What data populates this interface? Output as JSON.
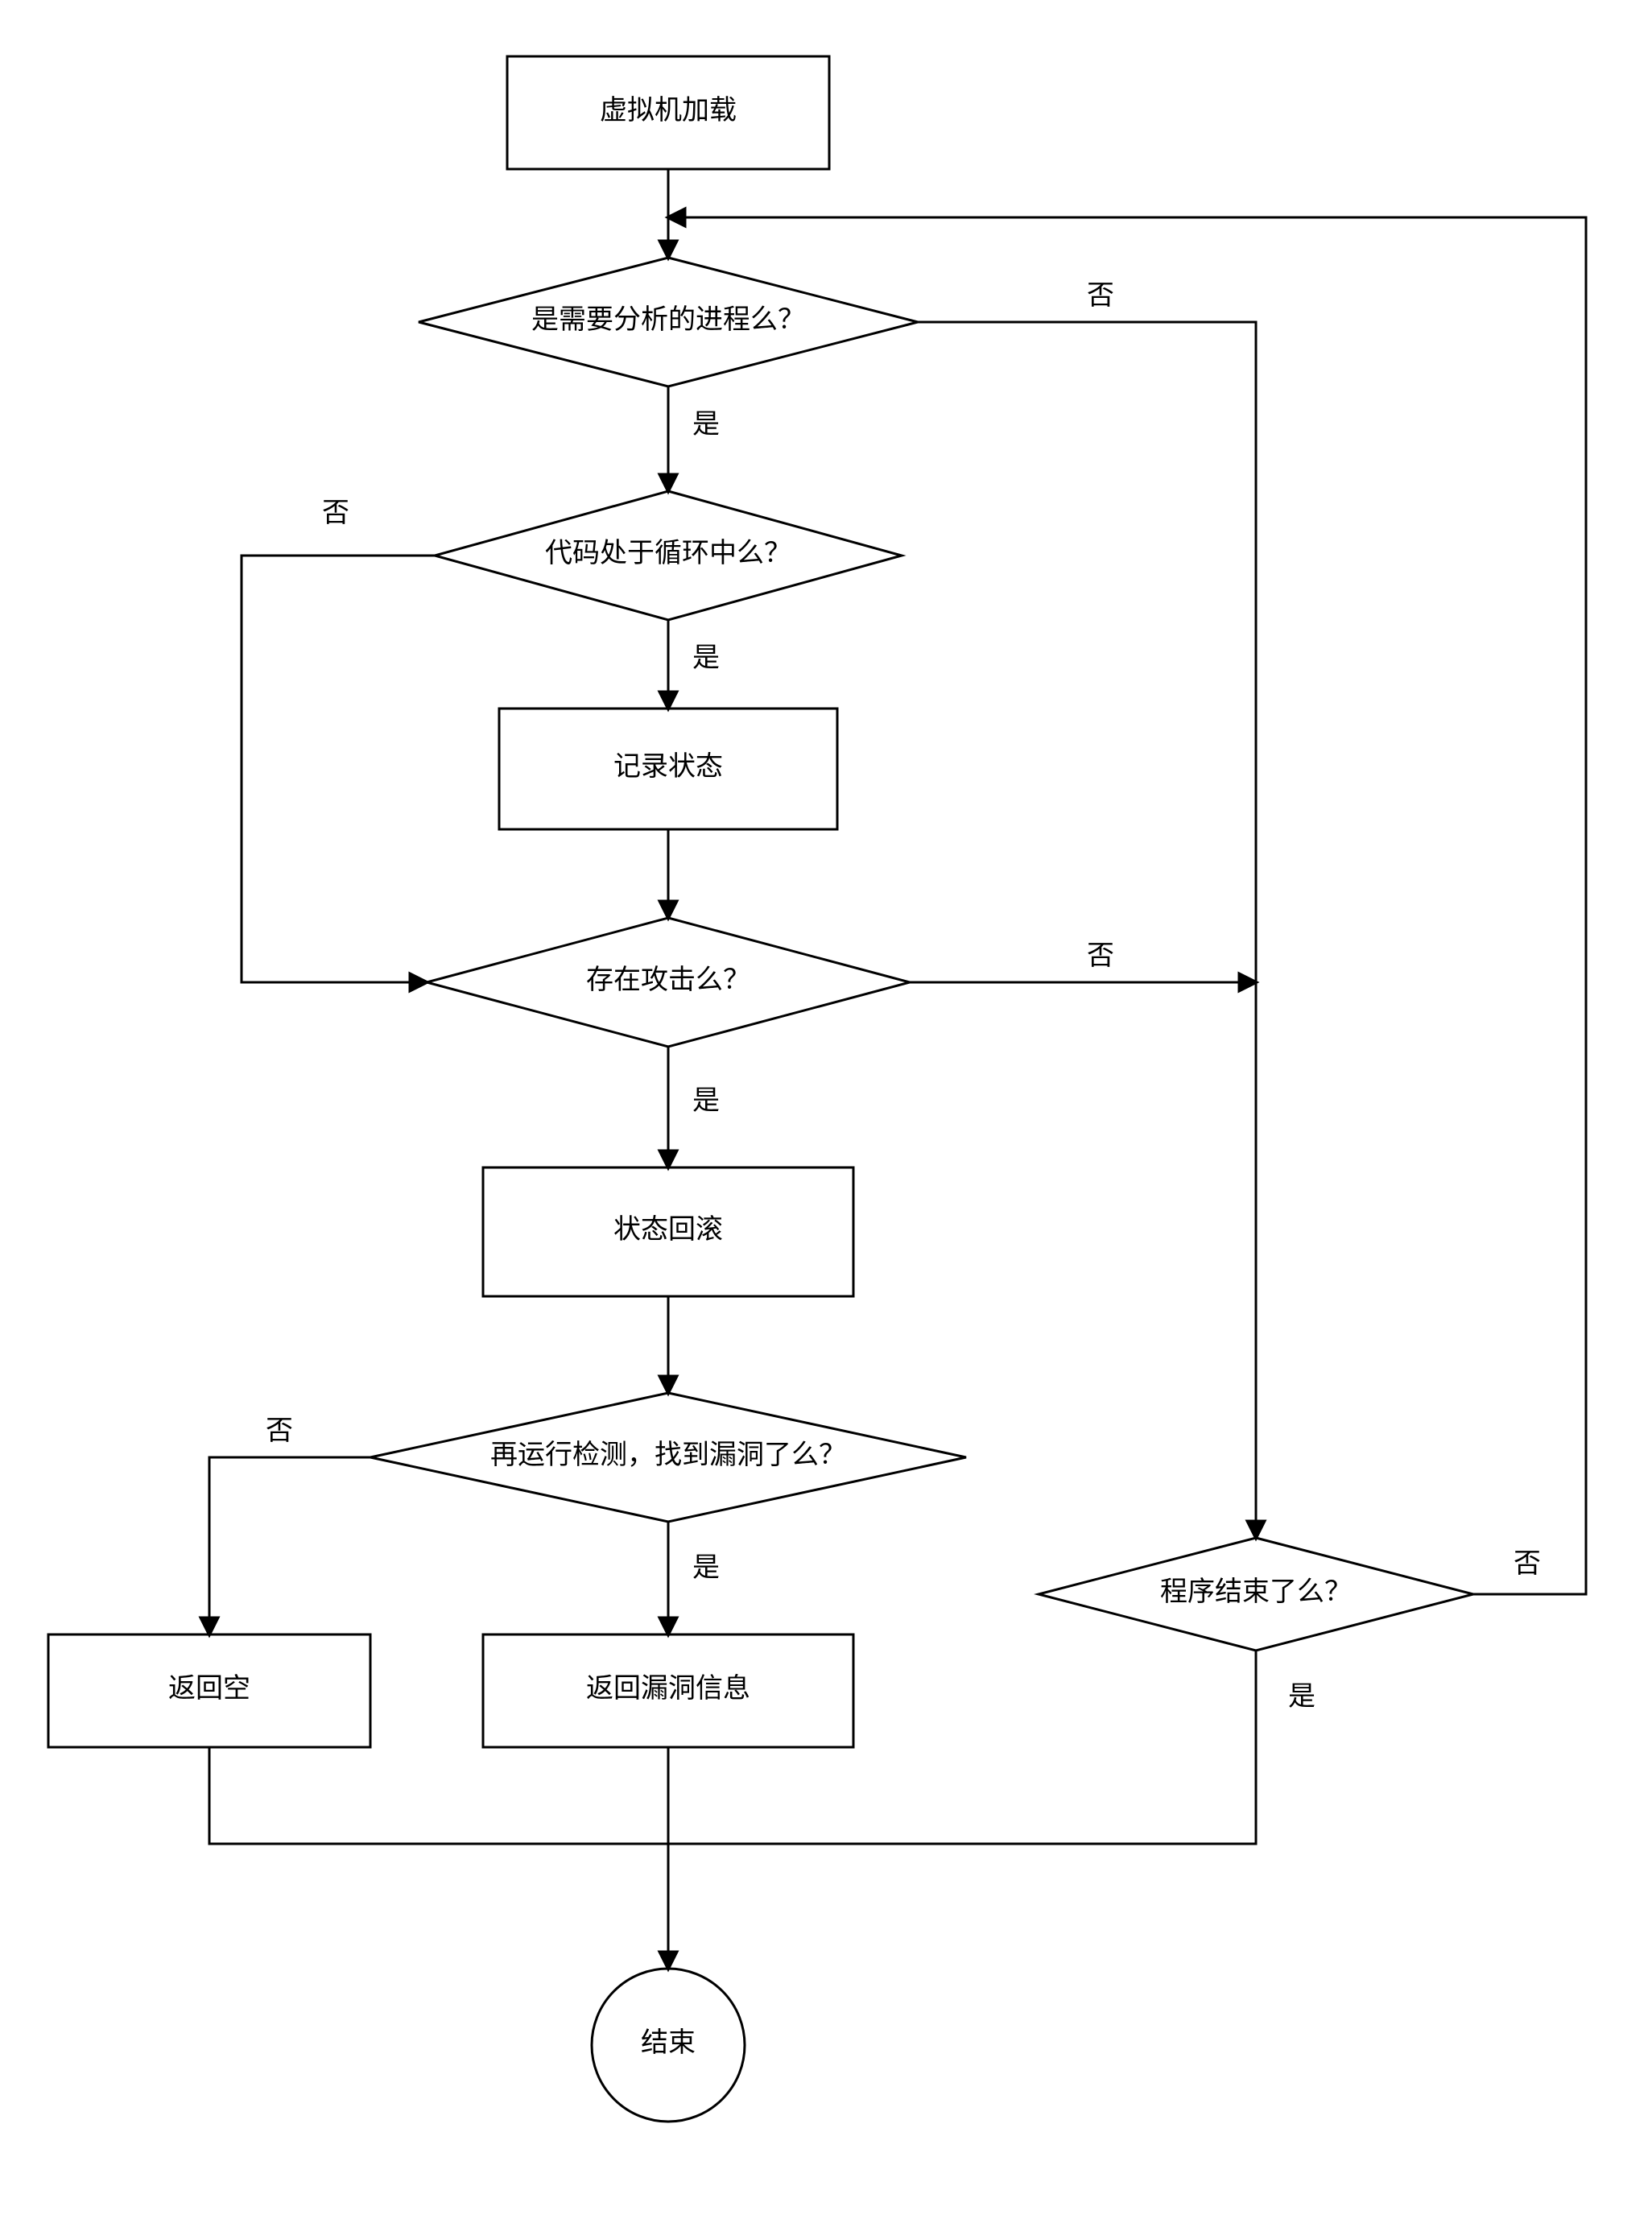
{
  "nodes": {
    "start": "虚拟机加载",
    "d1": "是需要分析的进程么？",
    "d2": "代码处于循环中么？",
    "p1": "记录状态",
    "d3": "存在攻击么？",
    "p2": "状态回滚",
    "d4": "再运行检测，找到漏洞了么？",
    "p3a": "返回空",
    "p3b": "返回漏洞信息",
    "d5": "程序结束了么？",
    "end": "结束"
  },
  "labels": {
    "yes": "是",
    "no": "否"
  }
}
